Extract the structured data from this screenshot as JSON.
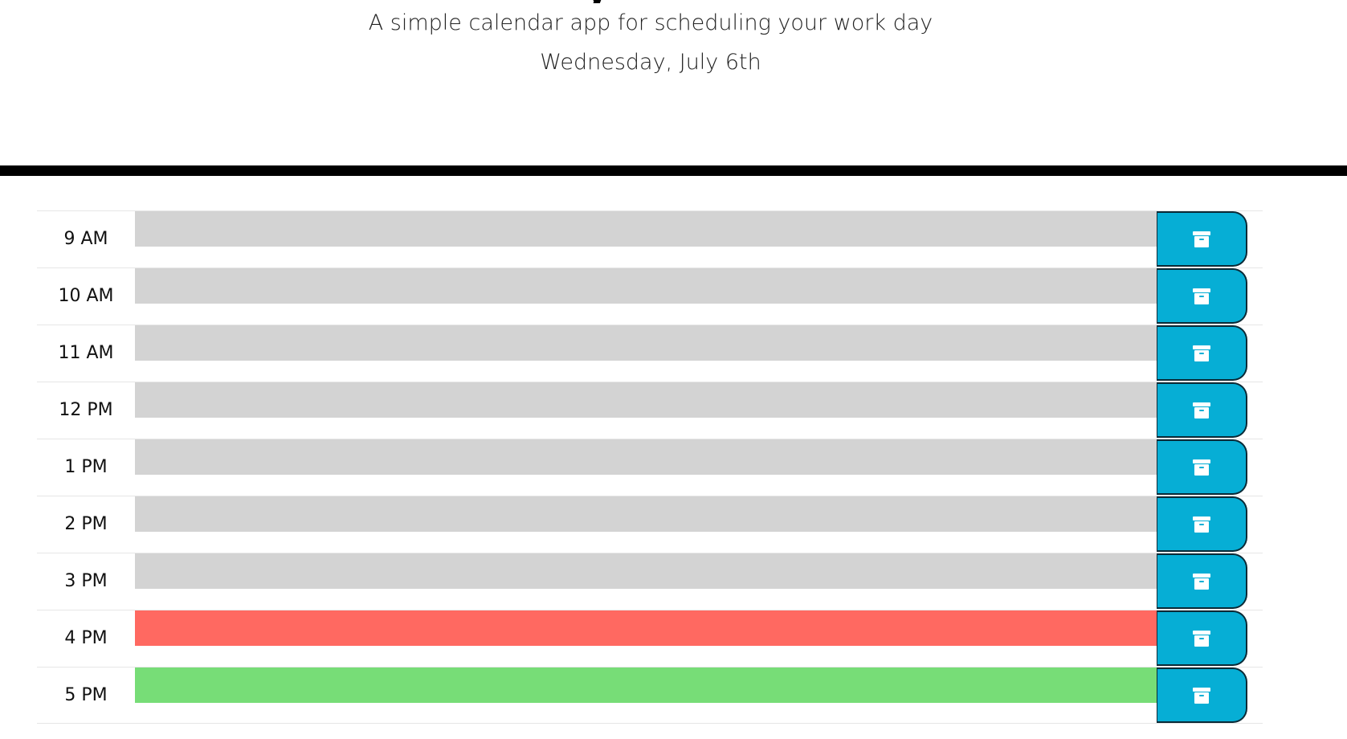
{
  "header": {
    "title_fragment": "y",
    "tagline": "A simple calendar app for scheduling your work day",
    "current_day": "Wednesday, July 6th"
  },
  "colors": {
    "past": "#d3d3d3",
    "present": "#ff6961",
    "future": "#77dd77",
    "save_button": "#06aed5"
  },
  "time_blocks": [
    {
      "hour": "9 AM",
      "state": "past",
      "text": "",
      "save_icon": "archive-icon"
    },
    {
      "hour": "10 AM",
      "state": "past",
      "text": "",
      "save_icon": "archive-icon"
    },
    {
      "hour": "11 AM",
      "state": "past",
      "text": "",
      "save_icon": "archive-icon"
    },
    {
      "hour": "12 PM",
      "state": "past",
      "text": "",
      "save_icon": "archive-icon"
    },
    {
      "hour": "1 PM",
      "state": "past",
      "text": "",
      "save_icon": "archive-icon"
    },
    {
      "hour": "2 PM",
      "state": "past",
      "text": "",
      "save_icon": "archive-icon"
    },
    {
      "hour": "3 PM",
      "state": "past",
      "text": "",
      "save_icon": "archive-icon"
    },
    {
      "hour": "4 PM",
      "state": "present",
      "text": "",
      "save_icon": "archive-icon"
    },
    {
      "hour": "5 PM",
      "state": "future",
      "text": "",
      "save_icon": "archive-icon"
    }
  ]
}
